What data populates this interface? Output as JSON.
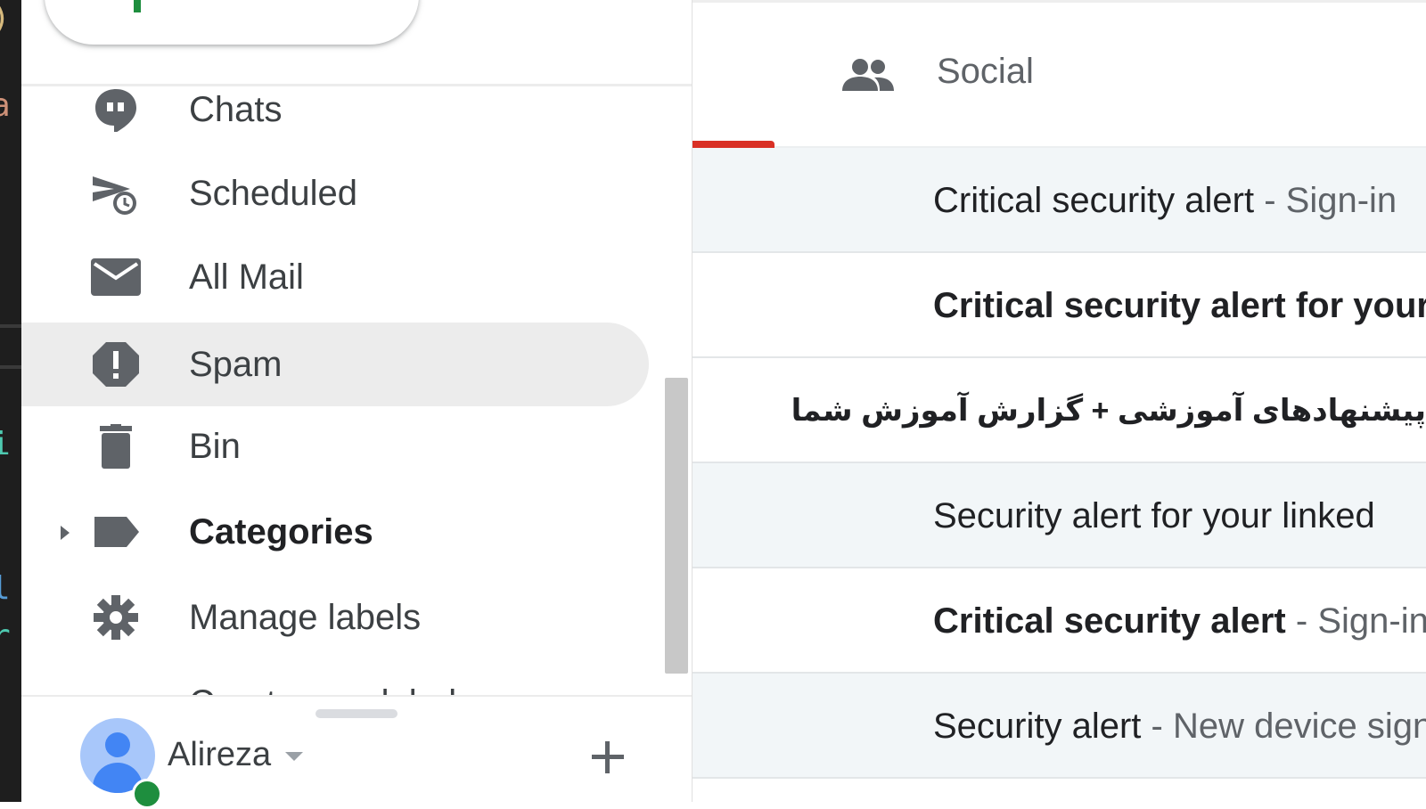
{
  "sidebar": {
    "items": [
      {
        "label": "Chats",
        "icon": "chat-icon"
      },
      {
        "label": "Scheduled",
        "icon": "scheduled-icon"
      },
      {
        "label": "All Mail",
        "icon": "mail-icon"
      },
      {
        "label": "Spam",
        "icon": "spam-icon",
        "active": true
      },
      {
        "label": "Bin",
        "icon": "trash-icon"
      },
      {
        "label": "Categories",
        "icon": "label-icon",
        "bold": true,
        "expandable": true
      },
      {
        "label": "Manage labels",
        "icon": "gear-icon"
      },
      {
        "label": "Create new label",
        "icon": "plus-icon"
      }
    ],
    "account": {
      "name": "Alireza"
    }
  },
  "main": {
    "tab": {
      "label": "Social",
      "icon": "people-icon"
    },
    "rows": [
      {
        "subject": "Critical security alert",
        "snippet": "Sign-in",
        "unread": false
      },
      {
        "subject": "Critical security alert for your",
        "snippet": "",
        "unread": true
      },
      {
        "subject": "پیشنهادهای آموزشی + گزارش آموزش شما",
        "snippet": "",
        "unread": true,
        "rtl": true
      },
      {
        "subject": "Security alert for your linked",
        "snippet": "",
        "unread": false
      },
      {
        "subject": "Critical security alert",
        "snippet": "Sign-in",
        "unread": true
      },
      {
        "subject": "Security alert",
        "snippet": "New device signed in",
        "unread": false
      }
    ],
    "separator": "-"
  },
  "colors": {
    "accent_red": "#d93025",
    "status_green": "#1e8e3e",
    "avatar_blue": "#4285f4",
    "active_bg": "#ececec",
    "read_row_bg": "#f2f6f8"
  }
}
